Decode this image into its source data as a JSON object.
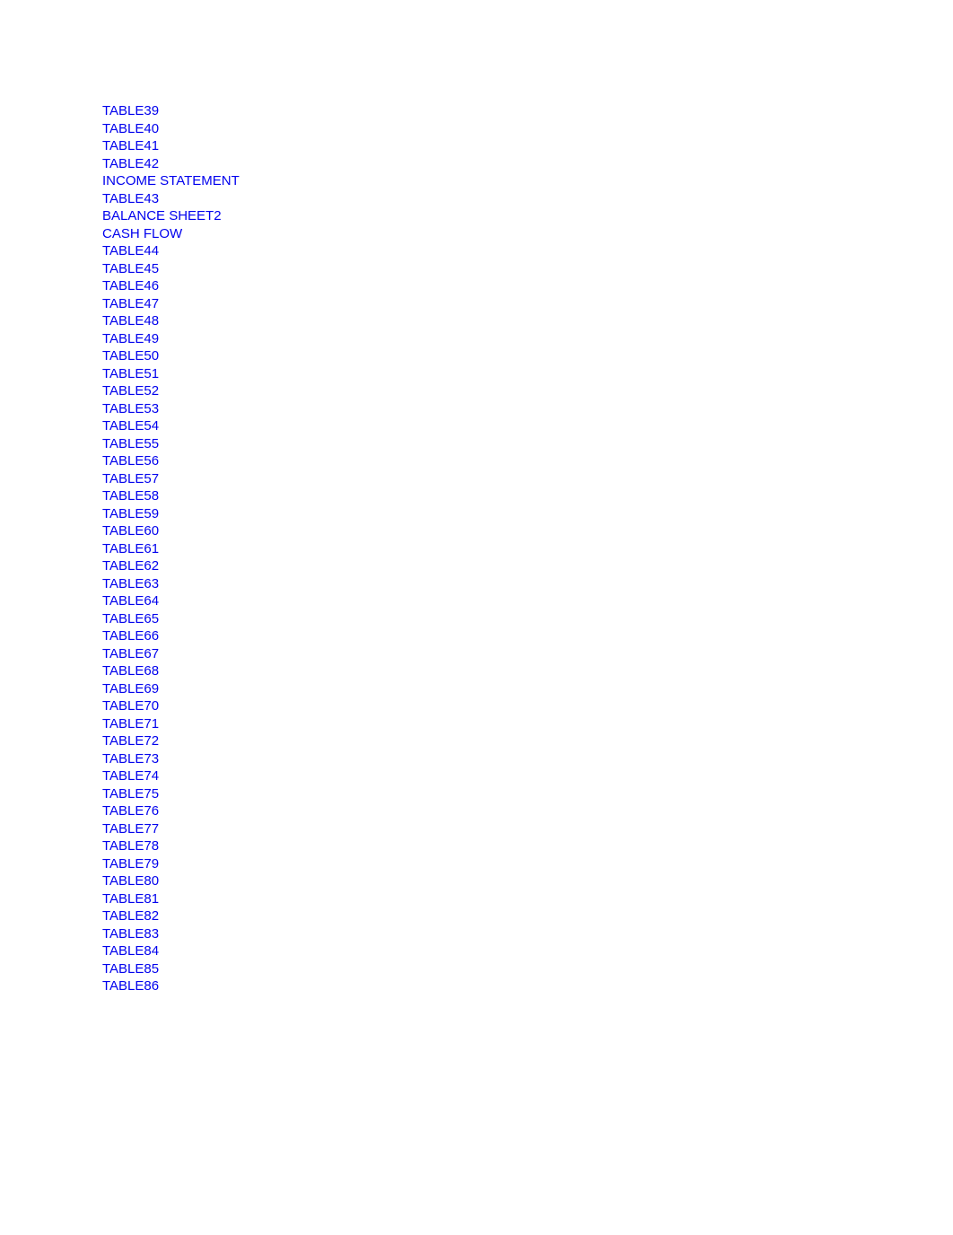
{
  "links": [
    "TABLE39",
    "TABLE40",
    "TABLE41",
    "TABLE42",
    "INCOME STATEMENT",
    "TABLE43",
    "BALANCE SHEET2",
    "CASH FLOW",
    "TABLE44",
    "TABLE45",
    "TABLE46",
    "TABLE47",
    "TABLE48",
    "TABLE49",
    "TABLE50",
    "TABLE51",
    "TABLE52",
    "TABLE53",
    "TABLE54",
    "TABLE55",
    "TABLE56",
    "TABLE57",
    "TABLE58",
    "TABLE59",
    "TABLE60",
    "TABLE61",
    "TABLE62",
    "TABLE63",
    "TABLE64",
    "TABLE65",
    "TABLE66",
    "TABLE67",
    "TABLE68",
    "TABLE69",
    "TABLE70",
    "TABLE71",
    "TABLE72",
    "TABLE73",
    "TABLE74",
    "TABLE75",
    "TABLE76",
    "TABLE77",
    "TABLE78",
    "TABLE79",
    "TABLE80",
    "TABLE81",
    "TABLE82",
    "TABLE83",
    "TABLE84",
    "TABLE85",
    "TABLE86"
  ]
}
